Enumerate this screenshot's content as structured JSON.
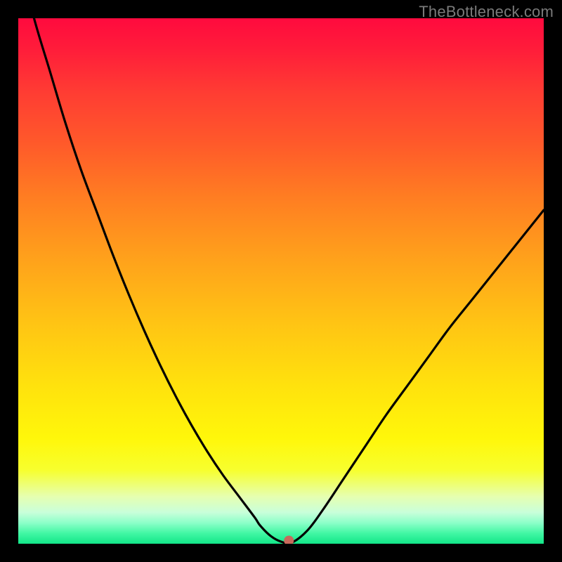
{
  "watermark": "TheBottleneck.com",
  "colors": {
    "frame": "#000000",
    "gradient_top": "#ff0a3e",
    "gradient_mid": "#ffe20d",
    "gradient_bottom": "#12e688",
    "curve": "#000000",
    "marker": "#c86a5c"
  },
  "chart_data": {
    "type": "line",
    "title": "",
    "xlabel": "",
    "ylabel": "",
    "xlim": [
      0,
      100
    ],
    "ylim": [
      0,
      100
    ],
    "x": [
      0,
      3,
      6,
      9,
      12,
      15,
      18,
      21,
      24,
      27,
      30,
      33,
      36,
      39,
      42,
      45,
      46,
      48,
      50,
      52,
      55,
      58,
      62,
      66,
      70,
      74,
      78,
      82,
      86,
      90,
      94,
      98,
      100
    ],
    "y": [
      112,
      100,
      90,
      80,
      71,
      63,
      55,
      47.5,
      40.5,
      34,
      28,
      22.5,
      17.5,
      13,
      9,
      5,
      3.5,
      1.5,
      0.4,
      0.2,
      2.5,
      6.5,
      12.5,
      18.5,
      24.5,
      30,
      35.5,
      41,
      46,
      51,
      56,
      61,
      63.5
    ],
    "annotations": [
      {
        "type": "point",
        "x": 51.5,
        "y": 0.6,
        "label": "minimum-marker"
      }
    ],
    "legend": false,
    "grid": false
  }
}
